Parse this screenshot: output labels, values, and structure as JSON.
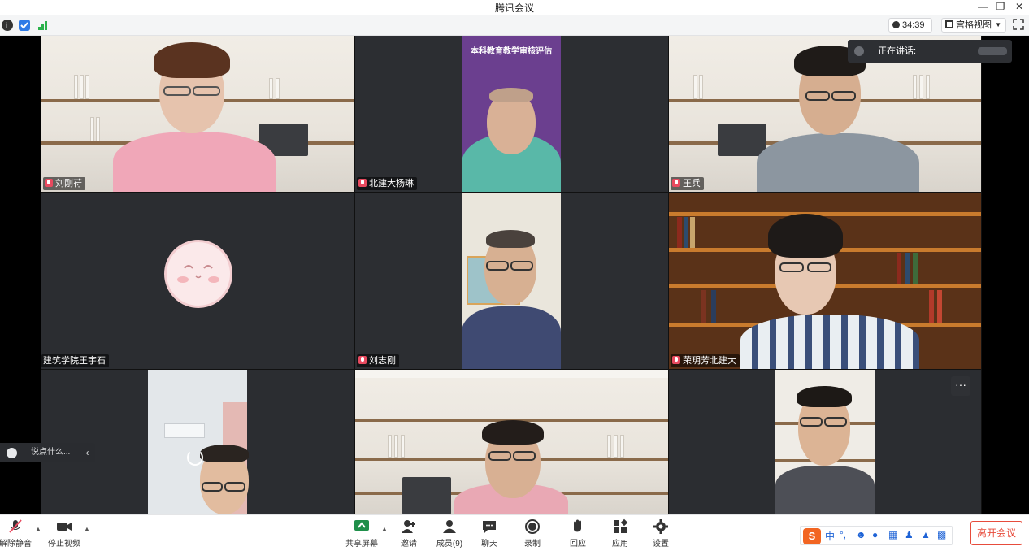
{
  "window": {
    "title": "腾讯会议",
    "minimize_icon": "minimize-icon",
    "restore_icon": "restore-icon",
    "close_icon": "close-icon"
  },
  "infobar": {
    "meeting_info_icon": "info-icon",
    "security_icon": "shield-icon",
    "network_icon": "signal-bars-icon",
    "elapsed_time": "34:39",
    "view_mode": "宫格视图",
    "fullscreen_icon": "fullscreen-icon"
  },
  "speaking_indicator": {
    "label": "正在讲话:"
  },
  "participants": [
    {
      "name": "刘刚苻"
    },
    {
      "name": "北建大杨琳",
      "banner": "本科教育教学审核评估"
    },
    {
      "name": "王兵"
    },
    {
      "name": "建筑学院王宇石"
    },
    {
      "name": "刘志刚"
    },
    {
      "name": "荣玥芳北建大"
    },
    {
      "name": ""
    },
    {
      "name": ""
    },
    {
      "name": ""
    }
  ],
  "chat": {
    "placeholder": "说点什么..."
  },
  "more_button": "···",
  "toolbar": {
    "mute_label": "解除静音",
    "video_label": "停止视频",
    "share_label": "共享屏幕",
    "invite_label": "邀请",
    "members_label": "成员(9)",
    "chat_label": "聊天",
    "record_label": "录制",
    "reaction_label": "回应",
    "apps_label": "应用",
    "settings_label": "设置",
    "leave_label": "离开会议"
  },
  "ime": {
    "logo": "S",
    "mode": "中"
  },
  "colors": {
    "accent_red": "#e74c3c",
    "ime_orange": "#f26522",
    "mic_muted": "#e84a5f"
  }
}
